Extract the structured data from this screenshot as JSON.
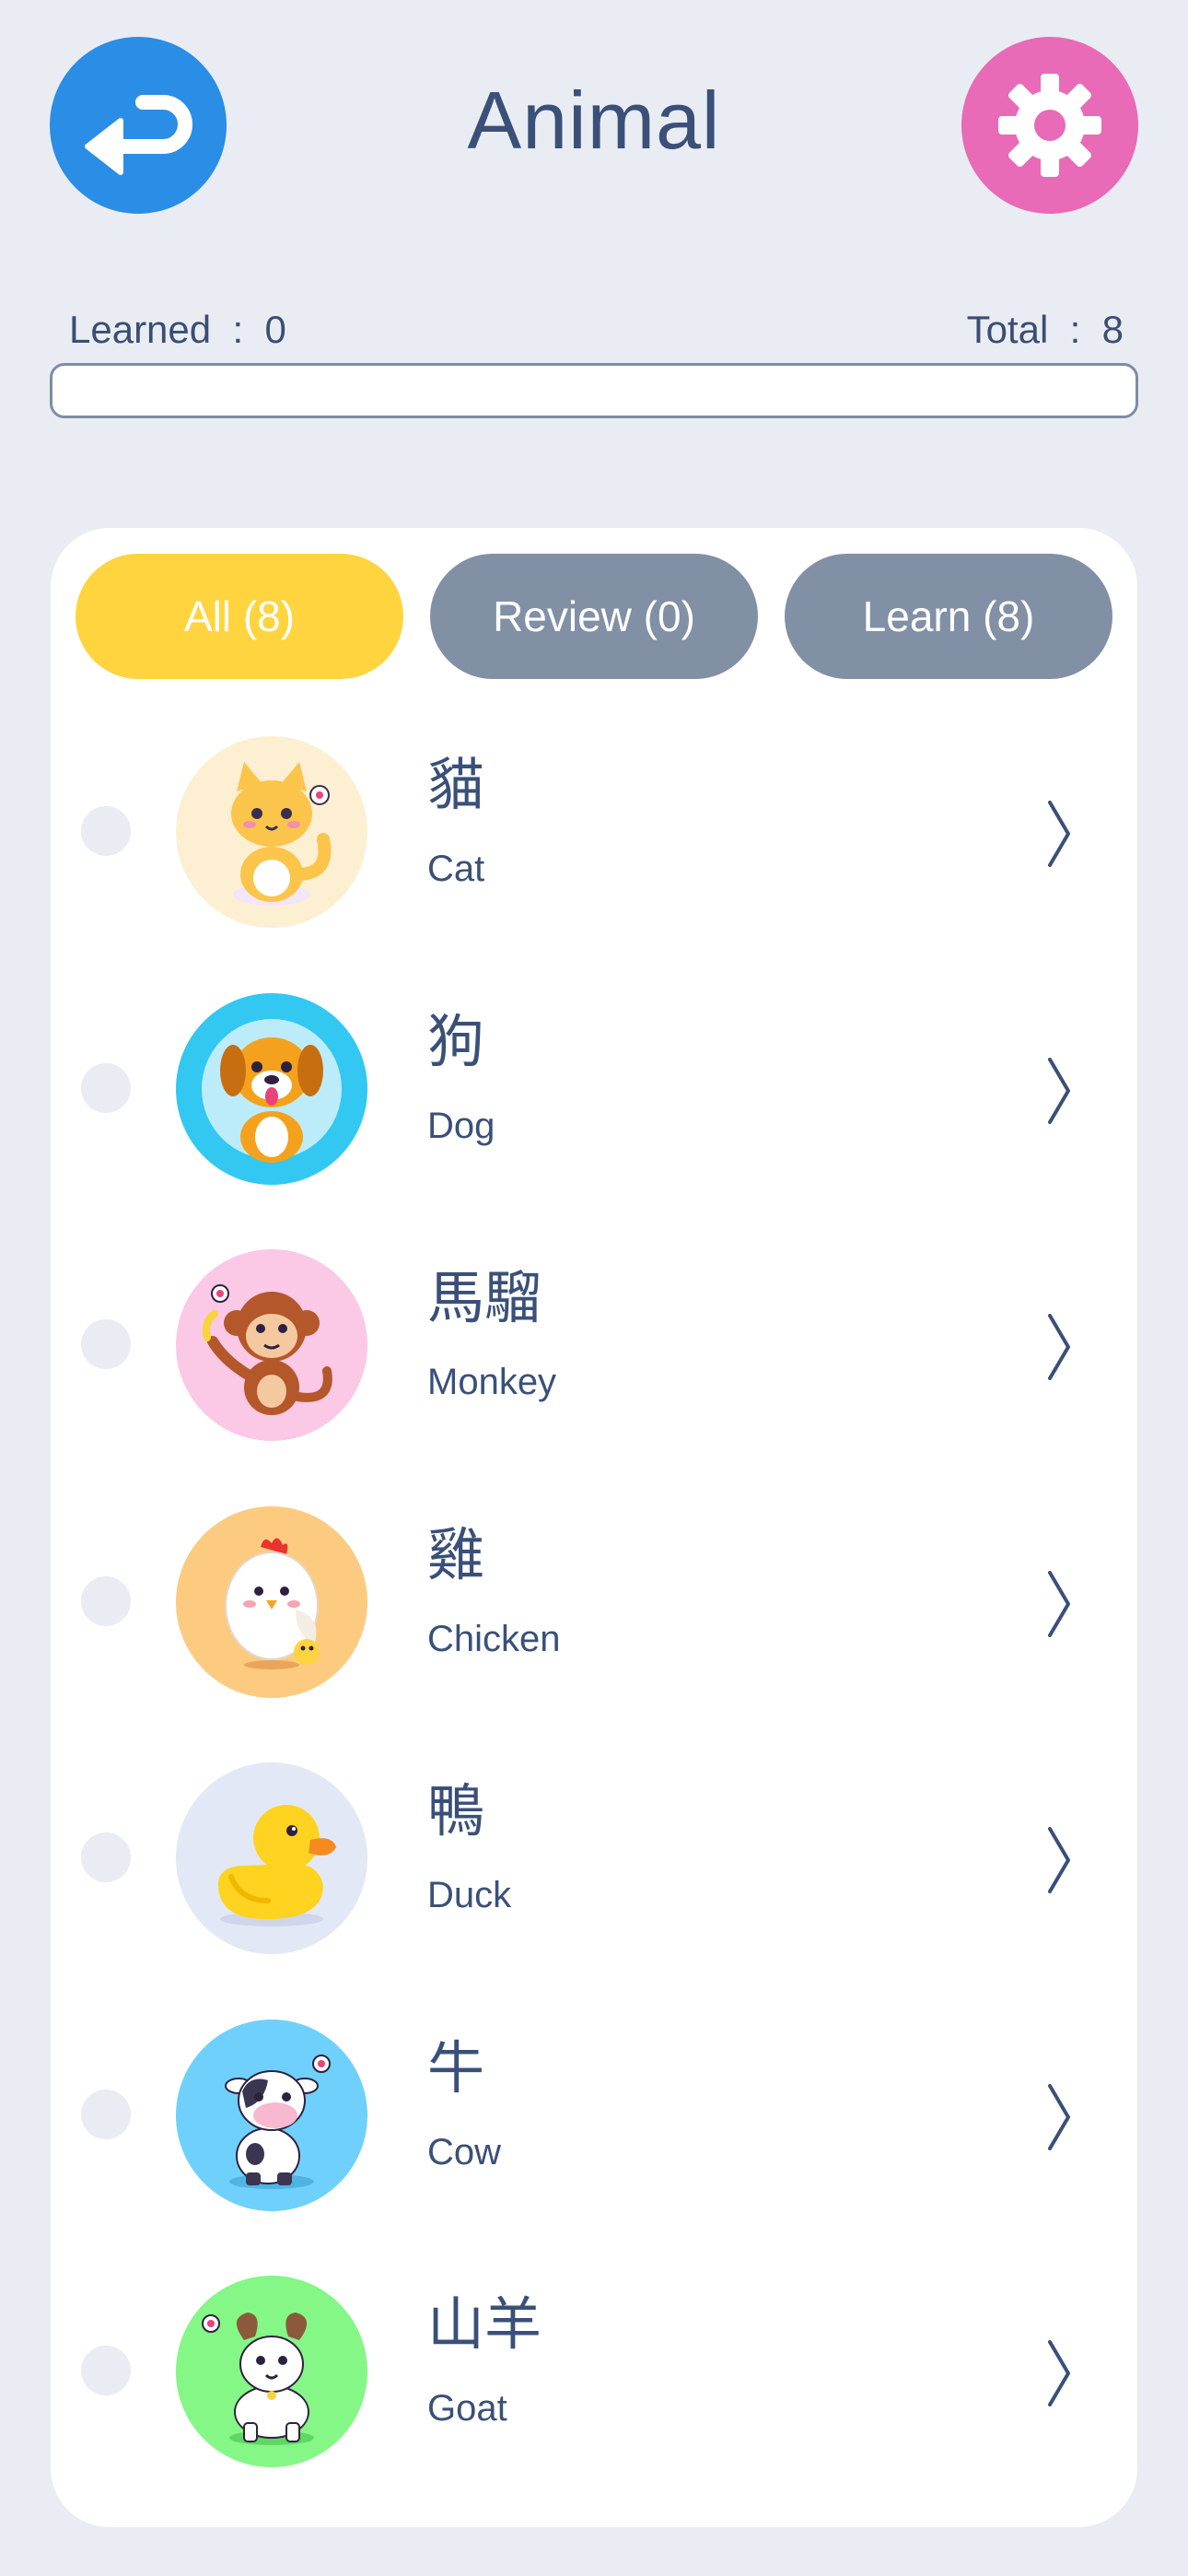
{
  "header": {
    "title": "Animal",
    "back_icon": "back-arrow-icon",
    "settings_icon": "gear-icon",
    "back_color": "#2A8DE6",
    "settings_color": "#E96AB7"
  },
  "progress": {
    "learned_label": "Learned",
    "learned_value": "0",
    "total_label": "Total",
    "total_value": "8",
    "learned_text": "Learned  :  0",
    "total_text": "Total  :  8",
    "fraction": 0
  },
  "filters": {
    "all": "All (8)",
    "review": "Review (0)",
    "learn": "Learn (8)",
    "active": "all",
    "active_color": "#FFD43E",
    "inactive_color": "#8290A6"
  },
  "items": [
    {
      "zh": "貓",
      "en": "Cat",
      "icon": "cat-icon",
      "bg": "#FDEFD2"
    },
    {
      "zh": "狗",
      "en": "Dog",
      "icon": "dog-icon",
      "bg": "#32C8F2"
    },
    {
      "zh": "馬騮",
      "en": "Monkey",
      "icon": "monkey-icon",
      "bg": "#FBC8E6"
    },
    {
      "zh": "雞",
      "en": "Chicken",
      "icon": "chicken-icon",
      "bg": "#FDCB80"
    },
    {
      "zh": "鴨",
      "en": "Duck",
      "icon": "duck-icon",
      "bg": "#E3E8F6"
    },
    {
      "zh": "牛",
      "en": "Cow",
      "icon": "cow-icon",
      "bg": "#6FD0FB"
    },
    {
      "zh": "山羊",
      "en": "Goat",
      "icon": "goat-icon",
      "bg": "#84F786"
    }
  ]
}
